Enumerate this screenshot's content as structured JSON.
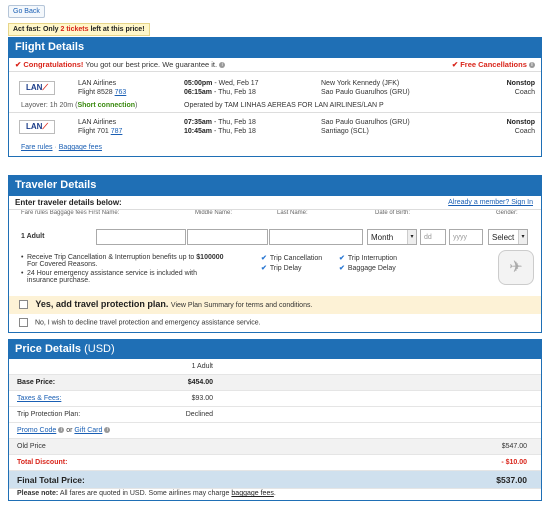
{
  "nav": {
    "go_back": "Go Back"
  },
  "banner": {
    "prefix": "Act fast:",
    "only": "Only",
    "count": "2 tickets",
    "suffix": "left at this price!"
  },
  "flight": {
    "title": "Flight Details",
    "congrats_strong": "Congratulations!",
    "congrats_text": "You got our best price. We guarantee it.",
    "free_cancel": "Free Cancellations",
    "segments": [
      {
        "airline": "LAN Airlines",
        "flight_label": "Flight 8528",
        "flight_num": "763",
        "dep_time": "05:00pm",
        "dep_day": " - Wed, Feb 17",
        "arr_time": "06:15am",
        "arr_day": " - Thu, Feb 18",
        "from": "New York Kennedy (JFK)",
        "to": "Sao Paulo Guarulhos (GRU)",
        "stops": "Nonstop",
        "cabin": "Coach"
      },
      {
        "airline": "LAN Airlines",
        "flight_label": "Flight 701",
        "flight_num": "787",
        "dep_time": "07:35am",
        "dep_day": " - Thu, Feb 18",
        "arr_time": "10:45am",
        "arr_day": " - Thu, Feb 18",
        "from": "Sao Paulo Guarulhos (GRU)",
        "to": "Santiago (SCL)",
        "stops": "Nonstop",
        "cabin": "Coach"
      }
    ],
    "layover": "Layover: 1h 20m",
    "short_connection": "Short connection",
    "operated_by": "Operated by TAM LINHAS AEREAS FOR LAN AIRLINES/LAN P",
    "fare_rules": "Fare rules",
    "baggage_fees": "Baggage fees",
    "logo_text": "LAN"
  },
  "traveler": {
    "title": "Traveler Details",
    "enter_label": "Enter traveler details below:",
    "member_link": "Already a member? Sign In",
    "col_headers": [
      "First Name:",
      "Middle Name:",
      "Last Name:",
      "Date of Birth:",
      "Gender:"
    ],
    "col_overlap": [
      "Fare rules",
      "Baggage fees"
    ],
    "row_label": "1  Adult",
    "month_label": "Month",
    "day_placeholder": "dd",
    "year_placeholder": "yyyy",
    "gender_label": "Select",
    "bullet1_a": "Receive Trip Cancellation & Interruption benefits up to",
    "bullet1_amount": "$100000",
    "bullet1_b": "For Covered Reasons.",
    "bullet2": "24 Hour emergency assistance service is included with insurance purchase.",
    "benefits": [
      "Trip Cancellation",
      "Trip Delay",
      "Trip Interruption",
      "Baggage Delay"
    ],
    "yes_strong": "Yes, add travel protection plan.",
    "yes_view": "View Plan Summary",
    "yes_rest": "for terms and conditions.",
    "no_text": "No, I wish to decline travel protection and emergency assistance service."
  },
  "price": {
    "title": "Price Details",
    "title_unit": "(USD)",
    "col_adult": "1 Adult",
    "base_label": "Base Price:",
    "base_value": "$454.00",
    "taxes_label": "Taxes & Fees:",
    "taxes_value": "$93.00",
    "protect_label": "Trip Protection Plan:",
    "protect_value": "Declined",
    "promo": "Promo Code",
    "or": "or",
    "gift": "Gift Card",
    "old_label": "Old Price",
    "old_value": "$547.00",
    "discount_label": "Total Discount:",
    "discount_value": "- $10.00",
    "final_label": "Final Total Price:",
    "final_value": "$537.00",
    "note_strong": "Please note:",
    "note_text": "All fares are quoted in USD. Some airlines may charge",
    "note_link": "baggage fees"
  },
  "colors": {
    "header_blue": "#1f6fb5",
    "alert_red": "#d9261c",
    "link_blue": "#1a5fb4"
  }
}
